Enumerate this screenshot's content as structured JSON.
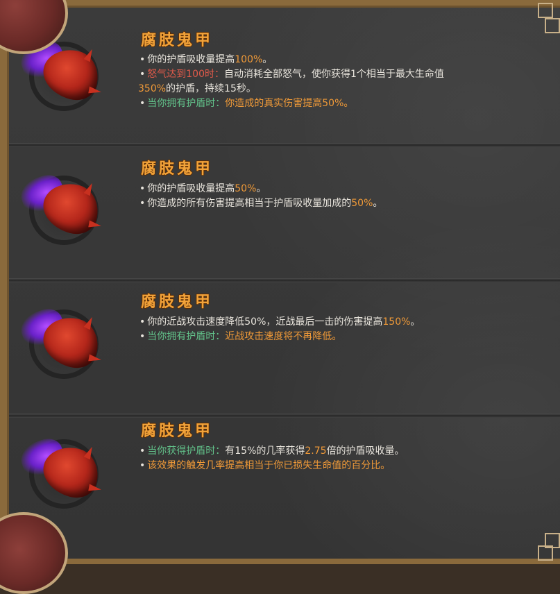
{
  "colors": {
    "title": "#f2a33a",
    "text": "#e8e4dc",
    "highlight_orange": "#f09a38",
    "highlight_red": "#e05a4a",
    "highlight_green": "#62c28a",
    "panel_bg": "#363636",
    "frame": "#8a6a3c"
  },
  "items": [
    {
      "title": "腐肢鬼甲",
      "icon": "corrupted-armor-icon",
      "lines": [
        {
          "bullet": "•",
          "parts": [
            {
              "t": "你的护盾吸收量提高",
              "c": "text"
            },
            {
              "t": "100%",
              "c": "orange"
            },
            {
              "t": "。",
              "c": "text"
            }
          ]
        },
        {
          "bullet": "•",
          "parts": [
            {
              "t": "怒气达到100时：",
              "c": "red"
            },
            {
              "t": "自动消耗全部怒气，使你获得1个相当于最大生命值",
              "c": "text"
            }
          ]
        },
        {
          "bullet": "",
          "parts": [
            {
              "t": "350%",
              "c": "orange"
            },
            {
              "t": "的护盾，持续15秒。",
              "c": "text"
            }
          ]
        },
        {
          "bullet": "•",
          "parts": [
            {
              "t": "当你拥有护盾时：",
              "c": "green"
            },
            {
              "t": "你造成的真实伤害提高50%。",
              "c": "orange"
            }
          ]
        }
      ]
    },
    {
      "title": "腐肢鬼甲",
      "icon": "corrupted-armor-icon",
      "lines": [
        {
          "bullet": "•",
          "parts": [
            {
              "t": "你的护盾吸收量提高",
              "c": "text"
            },
            {
              "t": "50%",
              "c": "orange"
            },
            {
              "t": "。",
              "c": "text"
            }
          ]
        },
        {
          "bullet": "•",
          "parts": [
            {
              "t": "你造成的所有伤害提高相当于护盾吸收量加成的",
              "c": "text"
            },
            {
              "t": "50%",
              "c": "orange"
            },
            {
              "t": "。",
              "c": "text"
            }
          ]
        }
      ]
    },
    {
      "title": "腐肢鬼甲",
      "icon": "corrupted-armor-icon",
      "lines": [
        {
          "bullet": "•",
          "parts": [
            {
              "t": "你的近战攻击速度降低50%，近战最后一击的伤害提高",
              "c": "text"
            },
            {
              "t": "150%",
              "c": "orange"
            },
            {
              "t": "。",
              "c": "text"
            }
          ]
        },
        {
          "bullet": "•",
          "parts": [
            {
              "t": "当你拥有护盾时：",
              "c": "green"
            },
            {
              "t": "近战攻击速度将不再降低。",
              "c": "orange"
            }
          ]
        }
      ]
    },
    {
      "title": "腐肢鬼甲",
      "icon": "corrupted-armor-icon",
      "lines": [
        {
          "bullet": "•",
          "parts": [
            {
              "t": "当你获得护盾时：",
              "c": "green"
            },
            {
              "t": "有15%的几率获得",
              "c": "text"
            },
            {
              "t": "2.75",
              "c": "orange"
            },
            {
              "t": "倍的护盾吸收量。",
              "c": "text"
            }
          ]
        },
        {
          "bullet": "•",
          "parts": [
            {
              "t": "该效果的触发几率提高相当于你已损失生命值的百分比。",
              "c": "orange"
            }
          ]
        }
      ]
    }
  ]
}
